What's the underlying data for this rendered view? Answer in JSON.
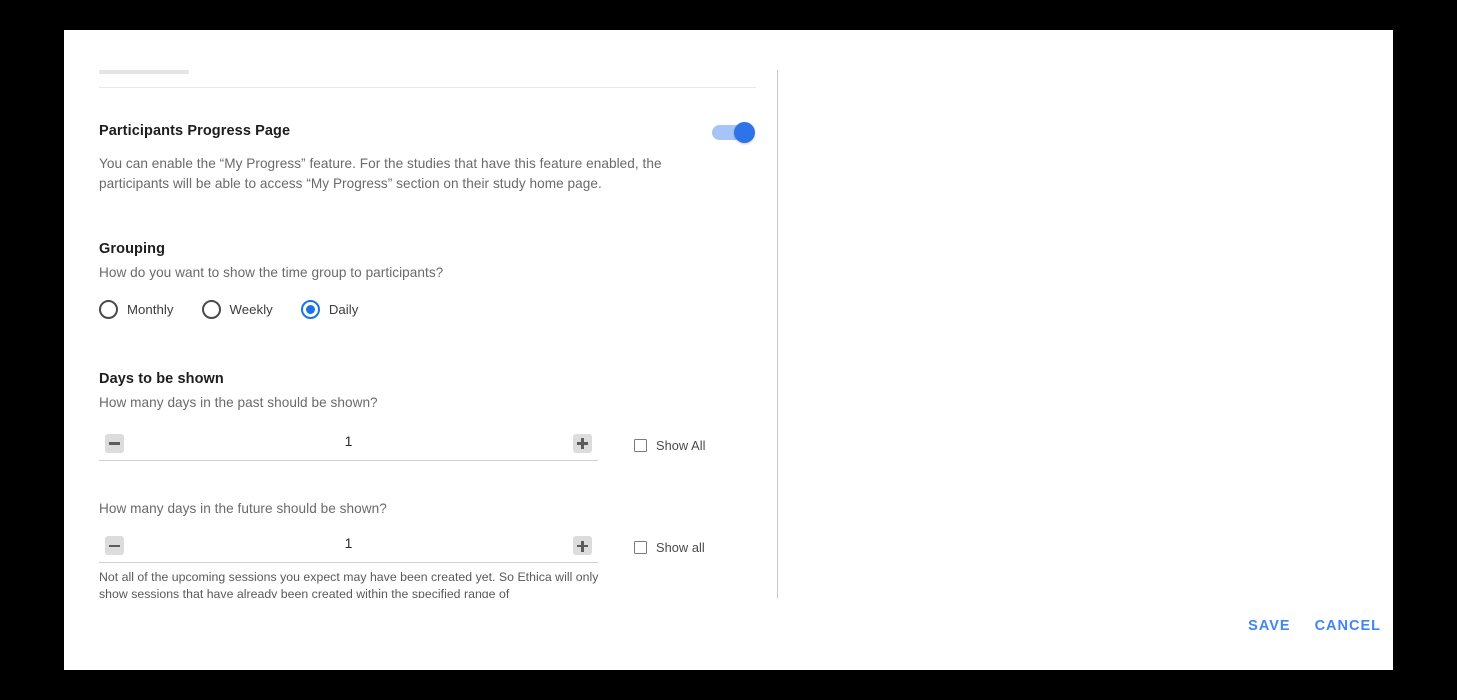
{
  "dialog": {
    "progress_page": {
      "title": "Participants Progress Page",
      "description": "You can enable the “My Progress” feature. For the studies that have this feature enabled, the participants will be able to access “My Progress” section on their study home page.",
      "toggle_state": "on"
    },
    "grouping": {
      "title": "Grouping",
      "question": "How do you want to show the time group to participants?",
      "options": [
        {
          "label": "Monthly",
          "selected": false
        },
        {
          "label": "Weekly",
          "selected": false
        },
        {
          "label": "Daily",
          "selected": true
        }
      ]
    },
    "days_to_be_shown": {
      "title": "Days to be shown",
      "past": {
        "question": "How many days in the past should be shown?",
        "value": "1",
        "decrement_label": "−",
        "increment_label": "+",
        "show_all_label": "Show All",
        "show_all_checked": false
      },
      "future": {
        "question": "How many days in the future should be shown?",
        "value": "1",
        "decrement_label": "−",
        "increment_label": "+",
        "show_all_label": "Show all",
        "show_all_checked": false,
        "note_line_1": "Not all of the upcoming sessions you expect may have been created yet. So Ethica will only",
        "note_line_2": "show sessions that have already been created within the specified range of"
      }
    },
    "footer": {
      "save_label": "SAVE",
      "cancel_label": "CANCEL"
    }
  },
  "colors": {
    "accent_blue": "#4285f4",
    "radio_blue": "#1a73e8",
    "toggle_track": "#a7c4f7",
    "toggle_thumb": "#2f73e8",
    "backdrop": "#000000"
  }
}
